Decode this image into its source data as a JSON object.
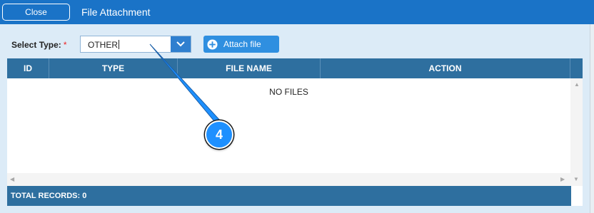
{
  "header": {
    "close_label": "Close",
    "title": "File Attachment"
  },
  "form": {
    "type_label": "Select Type:",
    "required_mark": "*",
    "type_value": "OTHER",
    "attach_label": "Attach file"
  },
  "grid": {
    "columns": [
      "ID",
      "TYPE",
      "FILE NAME",
      "ACTION"
    ],
    "empty_text": "NO FILES",
    "footer": "TOTAL RECORDS: 0"
  },
  "annotation": {
    "step": "4"
  },
  "colors": {
    "header_bg": "#1a73c7",
    "grid_header_bg": "#2e6f9f",
    "accent": "#1e90ff"
  }
}
